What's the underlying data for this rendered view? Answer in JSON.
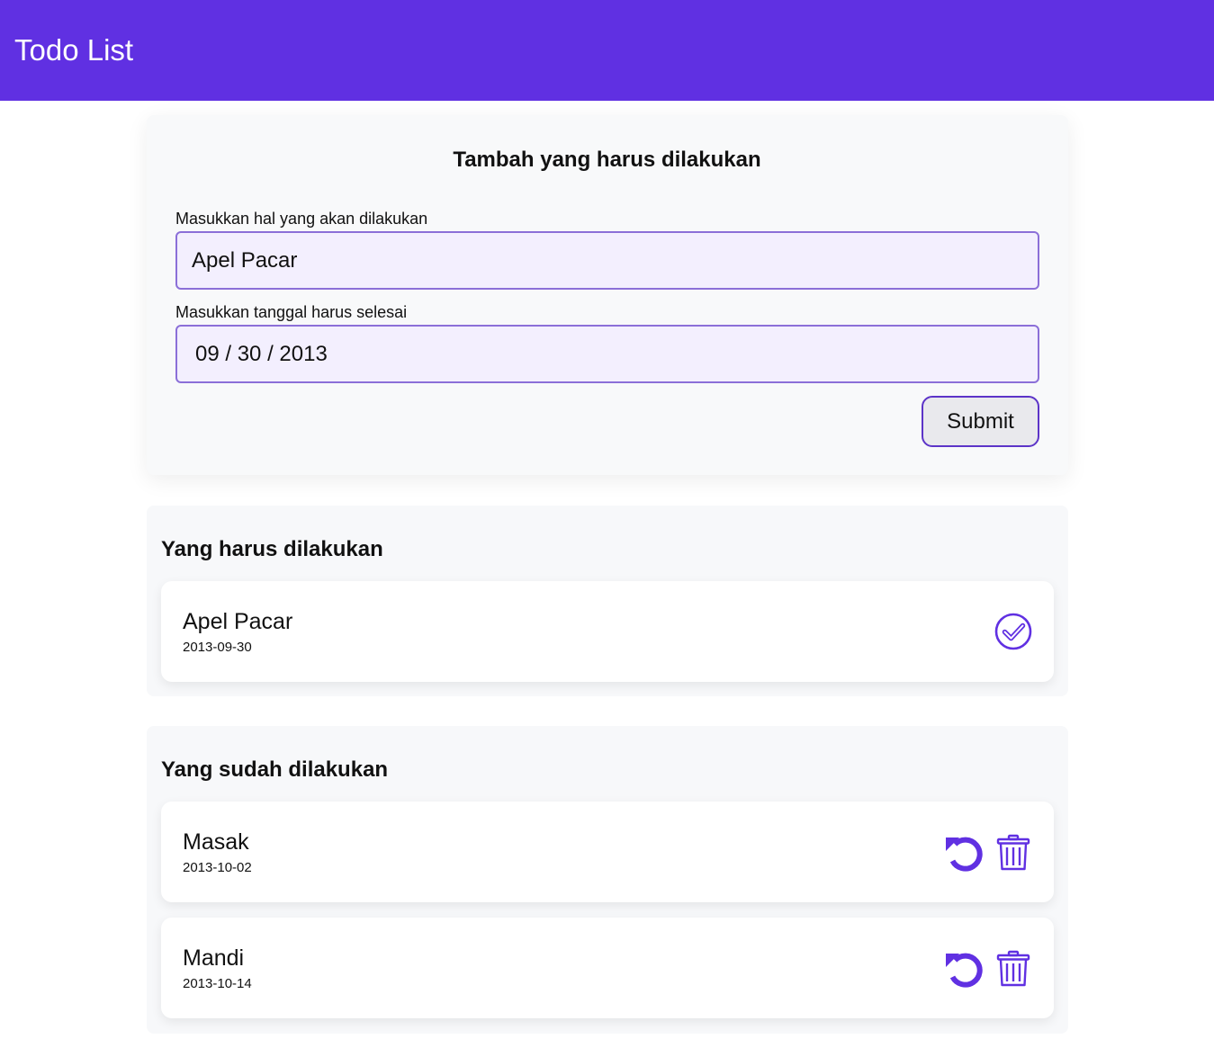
{
  "header": {
    "title": "Todo List"
  },
  "form": {
    "title": "Tambah yang harus dilakukan",
    "task_label": "Masukkan hal yang akan dilakukan",
    "task_value": "Apel Pacar",
    "date_label": "Masukkan tanggal harus selesai",
    "date_value": "09 / 30 / 2013",
    "submit_label": "Submit"
  },
  "todo_section": {
    "title": "Yang harus dilakukan",
    "items": [
      {
        "name": "Apel Pacar",
        "date": "2013-09-30",
        "icon": "check-circle-icon"
      }
    ]
  },
  "done_section": {
    "title": "Yang sudah dilakukan",
    "items": [
      {
        "name": "Masak",
        "date": "2013-10-02",
        "icons": [
          "undo-icon",
          "trash-icon"
        ]
      },
      {
        "name": "Mandi",
        "date": "2013-10-14",
        "icons": [
          "undo-icon",
          "trash-icon"
        ]
      }
    ]
  },
  "colors": {
    "accent": "#6030e2",
    "input_bg": "#f3effe",
    "input_border": "#8b6fd8",
    "section_bg": "#f7f8fa"
  }
}
